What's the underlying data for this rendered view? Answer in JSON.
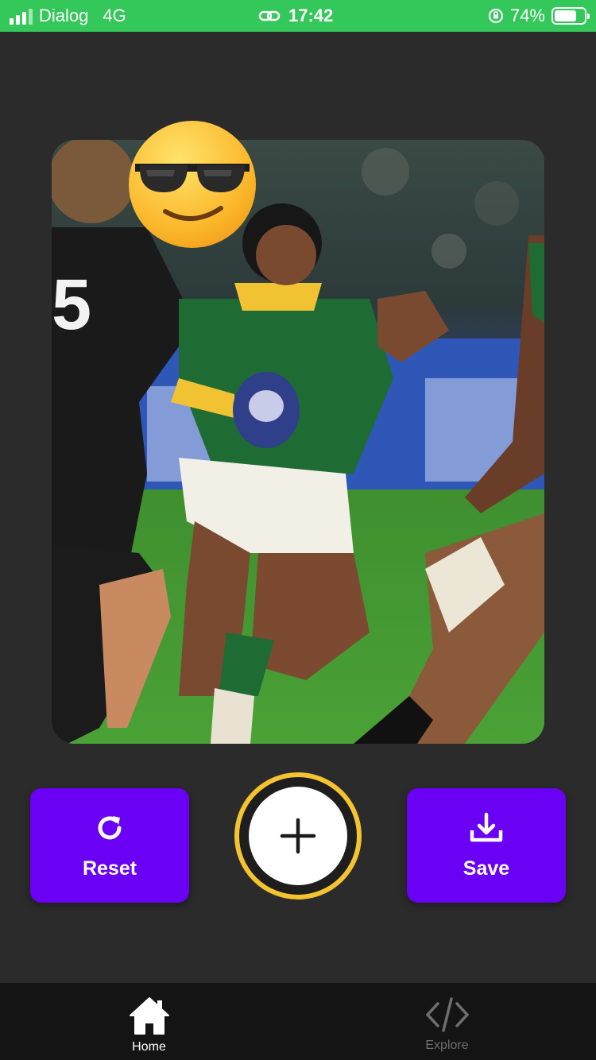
{
  "status_bar": {
    "carrier": "Dialog",
    "network": "4G",
    "time": "17:42",
    "battery_percent": "74%",
    "battery_level": 0.74
  },
  "photo": {
    "icon": "photo-preview",
    "sticker_icon": "sunglasses-emoji-icon"
  },
  "actions": {
    "reset_label": "Reset",
    "reset_icon": "refresh-icon",
    "save_label": "Save",
    "save_icon": "download-icon",
    "add_icon": "plus-icon"
  },
  "tabs": [
    {
      "label": "Home",
      "icon": "home-icon",
      "active": true
    },
    {
      "label": "Explore",
      "icon": "code-icon",
      "active": false
    }
  ],
  "colors": {
    "status_bar": "#34c759",
    "background": "#2b2b2b",
    "button": "#6a00f4",
    "add_ring": "#f4c430",
    "tab_bar": "#141414"
  }
}
